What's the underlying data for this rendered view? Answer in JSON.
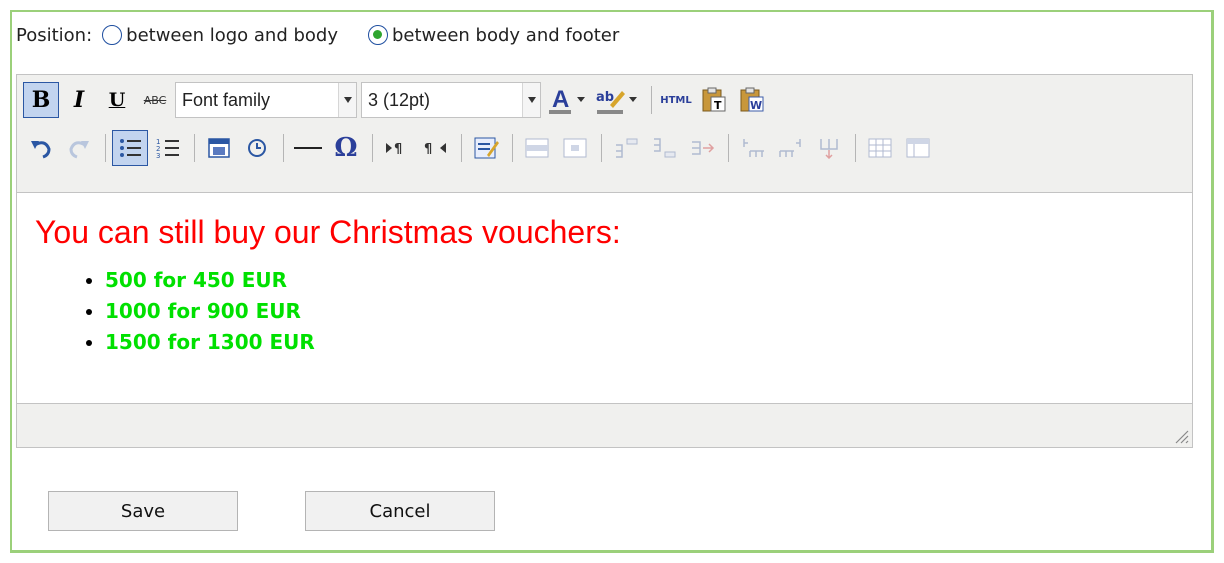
{
  "position": {
    "label": "Position:",
    "options": [
      {
        "label": "between logo and body",
        "checked": false
      },
      {
        "label": "between body and footer",
        "checked": true
      }
    ]
  },
  "toolbar": {
    "bold_label": "B",
    "italic_label": "I",
    "underline_label": "U",
    "strike_label": "ABC",
    "font_family": "Font family",
    "font_size": "3 (12pt)",
    "text_color_label": "A",
    "highlight_label": "ab",
    "html_label": "HTML",
    "paste_text_label": "T",
    "paste_word_label": "W",
    "omega_label": "Ω"
  },
  "editor": {
    "heading": "You can still buy our Christmas vouchers:",
    "items": [
      "500 for 450 EUR",
      "1000 for 900 EUR",
      "1500 for 1300 EUR"
    ]
  },
  "buttons": {
    "save": "Save",
    "cancel": "Cancel"
  },
  "colors": {
    "frame_border": "#9bd07a",
    "heading": "#ff0000",
    "list_text": "#00e000",
    "toolbar_bg": "#f0f0ee"
  }
}
